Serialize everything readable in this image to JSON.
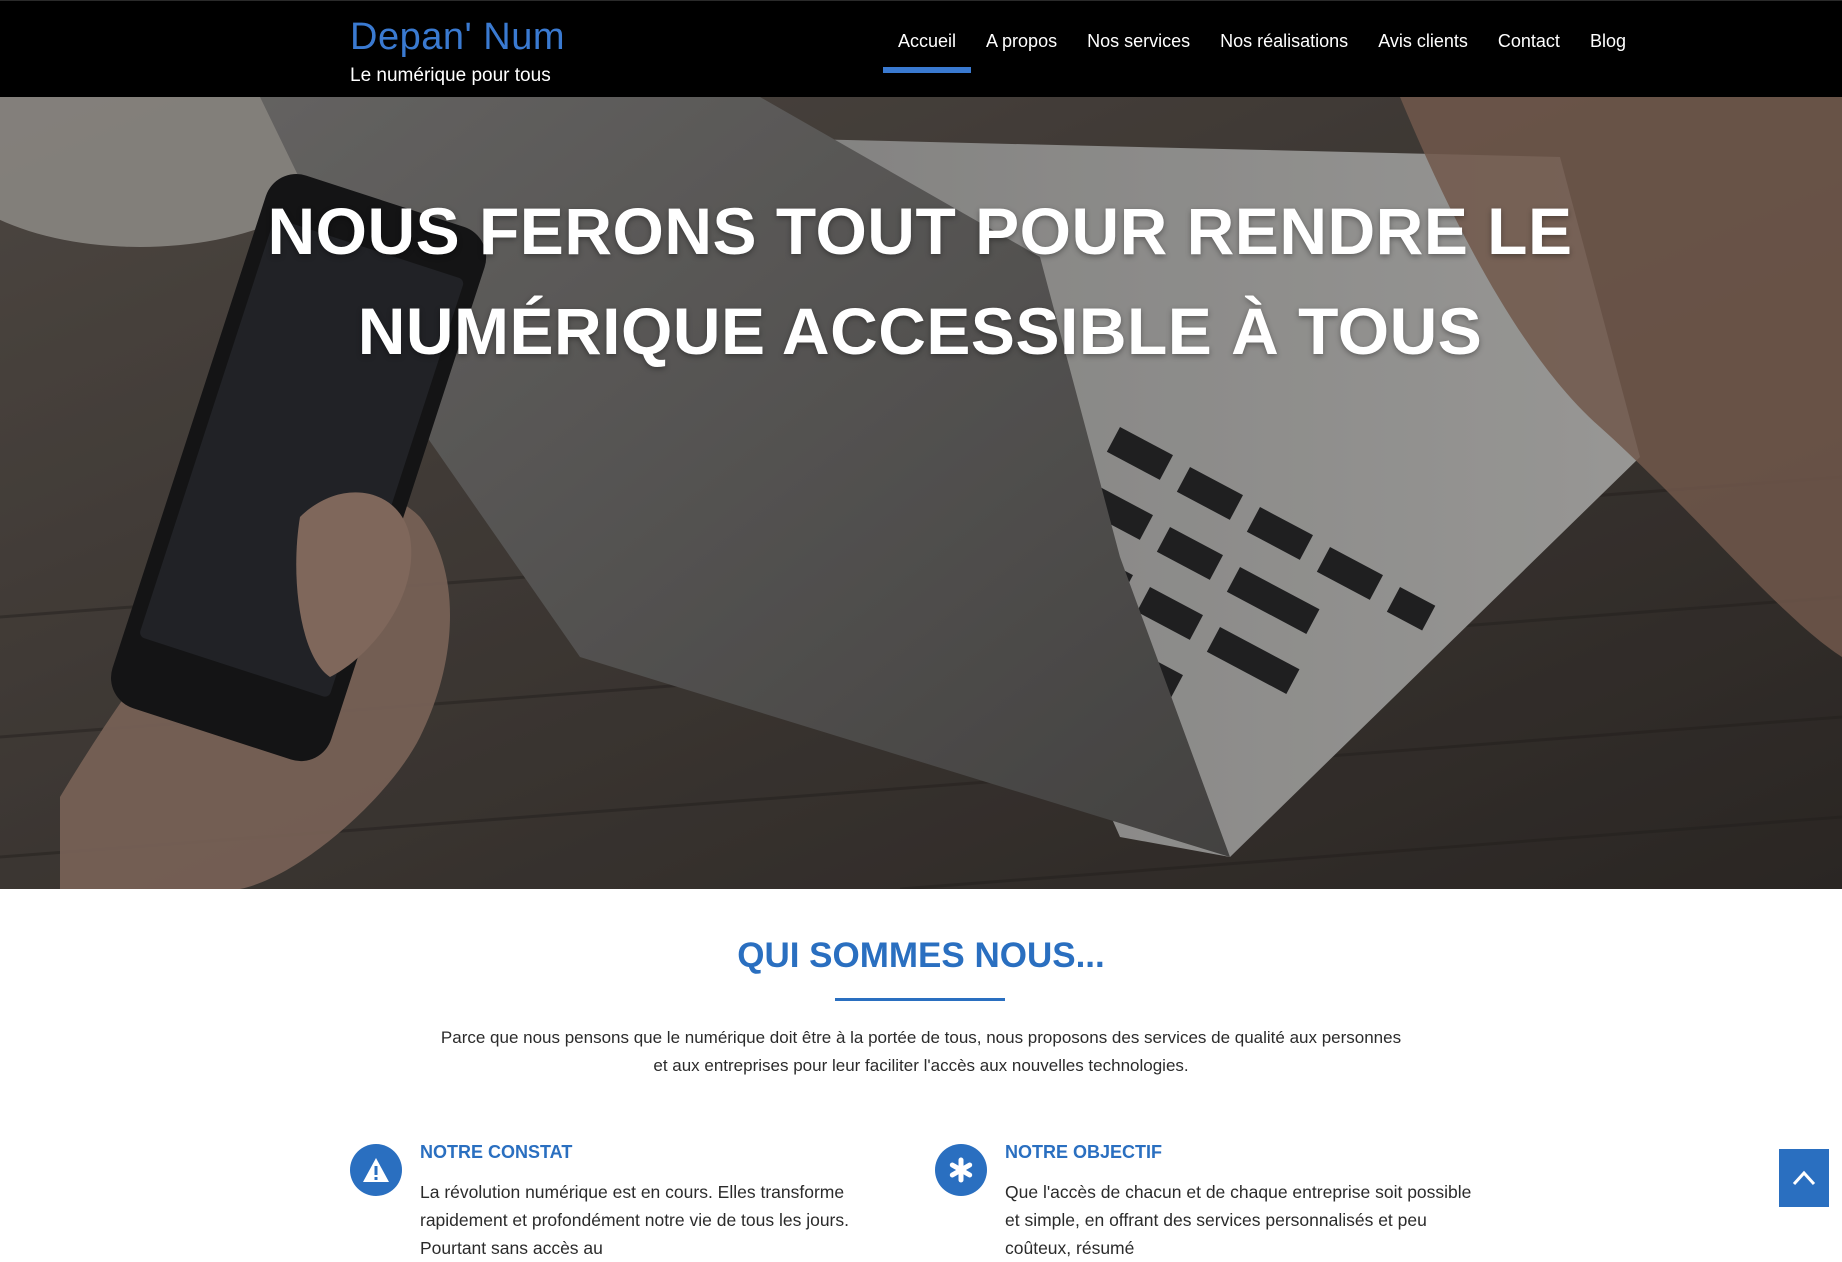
{
  "brand": {
    "name": "Depan' Num",
    "tagline": "Le numérique pour tous"
  },
  "nav": {
    "items": [
      {
        "label": "Accueil",
        "active": true
      },
      {
        "label": "A propos",
        "active": false
      },
      {
        "label": "Nos services",
        "active": false
      },
      {
        "label": "Nos réalisations",
        "active": false
      },
      {
        "label": "Avis clients",
        "active": false
      },
      {
        "label": "Contact",
        "active": false
      },
      {
        "label": "Blog",
        "active": false
      }
    ]
  },
  "hero": {
    "title": "NOUS FERONS TOUT POUR RENDRE LE NUMÉRIQUE ACCESSIBLE À TOUS",
    "image": "laptop-and-smartphone-photo"
  },
  "about": {
    "title": "QUI SOMMES NOUS...",
    "intro": "Parce que nous pensons que le numérique doit être à la portée de tous, nous proposons des services de qualité aux personnes et aux entreprises pour leur faciliter l'accès aux nouvelles technologies.",
    "features": [
      {
        "icon": "warning-icon",
        "title": "NOTRE CONSTAT",
        "text": "La révolution numérique est en cours. Elles transforme rapidement et profondément notre vie de tous les jours. Pourtant sans accès au"
      },
      {
        "icon": "asterisk-icon",
        "title": "NOTRE OBJECTIF",
        "text": "Que l'accès de chacun et de chaque entreprise soit possible et simple, en offrant des services personnalisés et peu coûteux, résumé"
      }
    ]
  },
  "scroll_top": {
    "icon": "chevron-up-icon"
  },
  "colors": {
    "accent": "#2a6fc0",
    "header_bg": "#000000",
    "brand": "#3a7ad1"
  }
}
